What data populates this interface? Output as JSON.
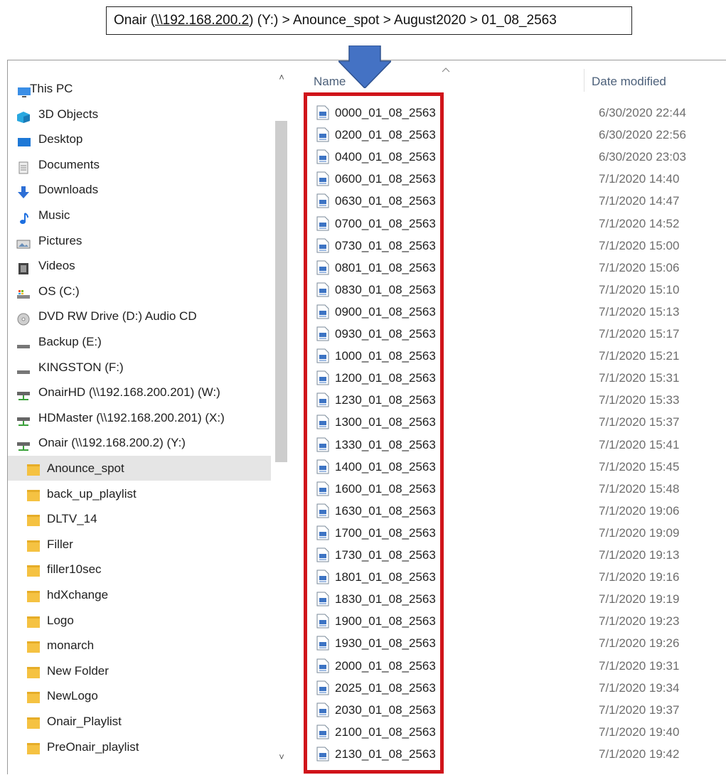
{
  "breadcrumb": {
    "drive_name": "Onair (",
    "unc": "\\\\192.168.200.2",
    "drive_letter": ") (Y:)",
    "sep": " > ",
    "folder1": "Anounce_spot",
    "folder2": "August2020",
    "folder3": "01_08_2563"
  },
  "colors": {
    "arrow": "#4472c4",
    "highlight": "#d0141a",
    "folder": "#f5c242",
    "selected_bg": "#e5e5e5"
  },
  "nav": {
    "items": [
      {
        "label": "This PC",
        "icon": "this-pc-icon"
      },
      {
        "label": "3D Objects",
        "icon": "3d-objects-icon"
      },
      {
        "label": "Desktop",
        "icon": "desktop-icon"
      },
      {
        "label": "Documents",
        "icon": "documents-icon"
      },
      {
        "label": "Downloads",
        "icon": "downloads-icon"
      },
      {
        "label": "Music",
        "icon": "music-icon"
      },
      {
        "label": "Pictures",
        "icon": "pictures-icon"
      },
      {
        "label": "Videos",
        "icon": "videos-icon"
      },
      {
        "label": "OS (C:)",
        "icon": "os-drive-icon"
      },
      {
        "label": "DVD RW Drive (D:) Audio CD",
        "icon": "dvd-drive-icon"
      },
      {
        "label": "Backup (E:)",
        "icon": "drive-icon"
      },
      {
        "label": "KINGSTON (F:)",
        "icon": "drive-icon"
      },
      {
        "label": "OnairHD (\\\\192.168.200.201) (W:)",
        "icon": "network-drive-icon"
      },
      {
        "label": "HDMaster (\\\\192.168.200.201) (X:)",
        "icon": "network-drive-icon"
      },
      {
        "label": "Onair (\\\\192.168.200.2) (Y:)",
        "icon": "network-drive-icon"
      },
      {
        "label": "Anounce_spot",
        "icon": "folder-icon",
        "selected": true
      },
      {
        "label": "back_up_playlist",
        "icon": "folder-icon"
      },
      {
        "label": "DLTV_14",
        "icon": "folder-icon"
      },
      {
        "label": "Filler",
        "icon": "folder-icon"
      },
      {
        "label": "filler10sec",
        "icon": "folder-icon"
      },
      {
        "label": "hdXchange",
        "icon": "folder-icon"
      },
      {
        "label": "Logo",
        "icon": "folder-icon"
      },
      {
        "label": "monarch",
        "icon": "folder-icon"
      },
      {
        "label": "New Folder",
        "icon": "folder-icon"
      },
      {
        "label": "NewLogo",
        "icon": "folder-icon"
      },
      {
        "label": "Onair_Playlist",
        "icon": "folder-icon"
      },
      {
        "label": "PreOnair_playlist",
        "icon": "folder-icon"
      }
    ]
  },
  "columns": {
    "name": "Name",
    "date": "Date modified"
  },
  "files": [
    {
      "name": "0000_01_08_2563",
      "date": "6/30/2020 22:44"
    },
    {
      "name": "0200_01_08_2563",
      "date": "6/30/2020 22:56"
    },
    {
      "name": "0400_01_08_2563",
      "date": "6/30/2020 23:03"
    },
    {
      "name": "0600_01_08_2563",
      "date": "7/1/2020 14:40"
    },
    {
      "name": "0630_01_08_2563",
      "date": "7/1/2020 14:47"
    },
    {
      "name": "0700_01_08_2563",
      "date": "7/1/2020 14:52"
    },
    {
      "name": "0730_01_08_2563",
      "date": "7/1/2020 15:00"
    },
    {
      "name": "0801_01_08_2563",
      "date": "7/1/2020 15:06"
    },
    {
      "name": "0830_01_08_2563",
      "date": "7/1/2020 15:10"
    },
    {
      "name": "0900_01_08_2563",
      "date": "7/1/2020 15:13"
    },
    {
      "name": "0930_01_08_2563",
      "date": "7/1/2020 15:17"
    },
    {
      "name": "1000_01_08_2563",
      "date": "7/1/2020 15:21"
    },
    {
      "name": "1200_01_08_2563",
      "date": "7/1/2020 15:31"
    },
    {
      "name": "1230_01_08_2563",
      "date": "7/1/2020 15:33"
    },
    {
      "name": "1300_01_08_2563",
      "date": "7/1/2020 15:37"
    },
    {
      "name": "1330_01_08_2563",
      "date": "7/1/2020 15:41"
    },
    {
      "name": "1400_01_08_2563",
      "date": "7/1/2020 15:45"
    },
    {
      "name": "1600_01_08_2563",
      "date": "7/1/2020 15:48"
    },
    {
      "name": "1630_01_08_2563",
      "date": "7/1/2020 19:06"
    },
    {
      "name": "1700_01_08_2563",
      "date": "7/1/2020 19:09"
    },
    {
      "name": "1730_01_08_2563",
      "date": "7/1/2020 19:13"
    },
    {
      "name": "1801_01_08_2563",
      "date": "7/1/2020 19:16"
    },
    {
      "name": "1830_01_08_2563",
      "date": "7/1/2020 19:19"
    },
    {
      "name": "1900_01_08_2563",
      "date": "7/1/2020 19:23"
    },
    {
      "name": "1930_01_08_2563",
      "date": "7/1/2020 19:26"
    },
    {
      "name": "2000_01_08_2563",
      "date": "7/1/2020 19:31"
    },
    {
      "name": "2025_01_08_2563",
      "date": "7/1/2020 19:34"
    },
    {
      "name": "2030_01_08_2563",
      "date": "7/1/2020 19:37"
    },
    {
      "name": "2100_01_08_2563",
      "date": "7/1/2020 19:40"
    },
    {
      "name": "2130_01_08_2563",
      "date": "7/1/2020 19:42"
    }
  ]
}
